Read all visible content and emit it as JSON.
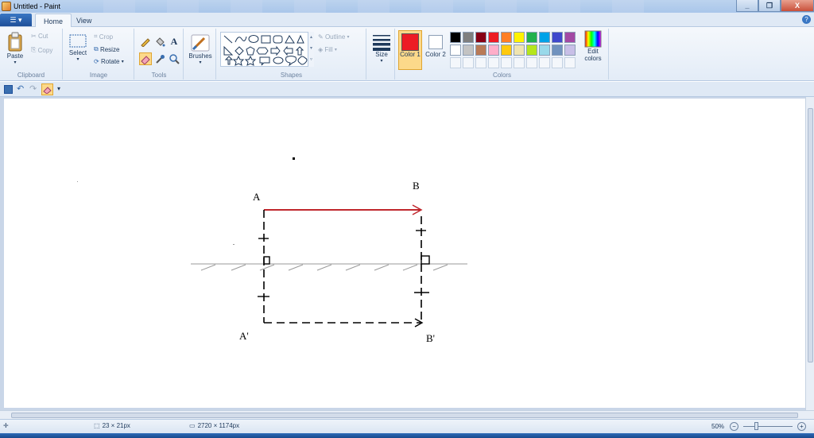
{
  "window": {
    "title": "Untitled - Paint",
    "controls": {
      "minimize": "_",
      "maximize": "❐",
      "close": "X"
    }
  },
  "tabs": [
    {
      "label": "Home",
      "active": true
    },
    {
      "label": "View",
      "active": false
    }
  ],
  "help": "?",
  "ribbon": {
    "clipboard": {
      "paste": "Paste",
      "cut": "Cut",
      "copy": "Copy",
      "label": "Clipboard"
    },
    "image": {
      "select": "Select",
      "crop": "Crop",
      "resize": "Resize",
      "rotate": "Rotate",
      "label": "Image"
    },
    "tools": {
      "label": "Tools"
    },
    "brushes": {
      "label": "Brushes"
    },
    "shapes": {
      "outline": "Outline",
      "fill": "Fill",
      "label": "Shapes"
    },
    "size": {
      "label": "Size"
    },
    "colors": {
      "color1": "Color 1",
      "color2": "Color 2",
      "edit": "Edit colors",
      "label": "Colors",
      "color1_value": "#ed1c24",
      "color2_value": "#ffffff",
      "palette_row1": [
        "#000000",
        "#7f7f7f",
        "#880015",
        "#ed1c24",
        "#ff7f27",
        "#fff200",
        "#22b14c",
        "#00a2e8",
        "#3f48cc",
        "#a349a4"
      ],
      "palette_row2": [
        "#ffffff",
        "#c3c3c3",
        "#b97a57",
        "#ffaec9",
        "#ffc90e",
        "#efe4b0",
        "#b5e61d",
        "#99d9ea",
        "#7092be",
        "#c8bfe7"
      ]
    }
  },
  "drawing": {
    "label_a": "A",
    "label_b": "B",
    "label_a_prime": "A'",
    "label_b_prime": "B'",
    "arrow_color": "#c0272d"
  },
  "status": {
    "selection_size": "23 × 21px",
    "image_size": "2720 × 1174px",
    "zoom": "50%"
  }
}
